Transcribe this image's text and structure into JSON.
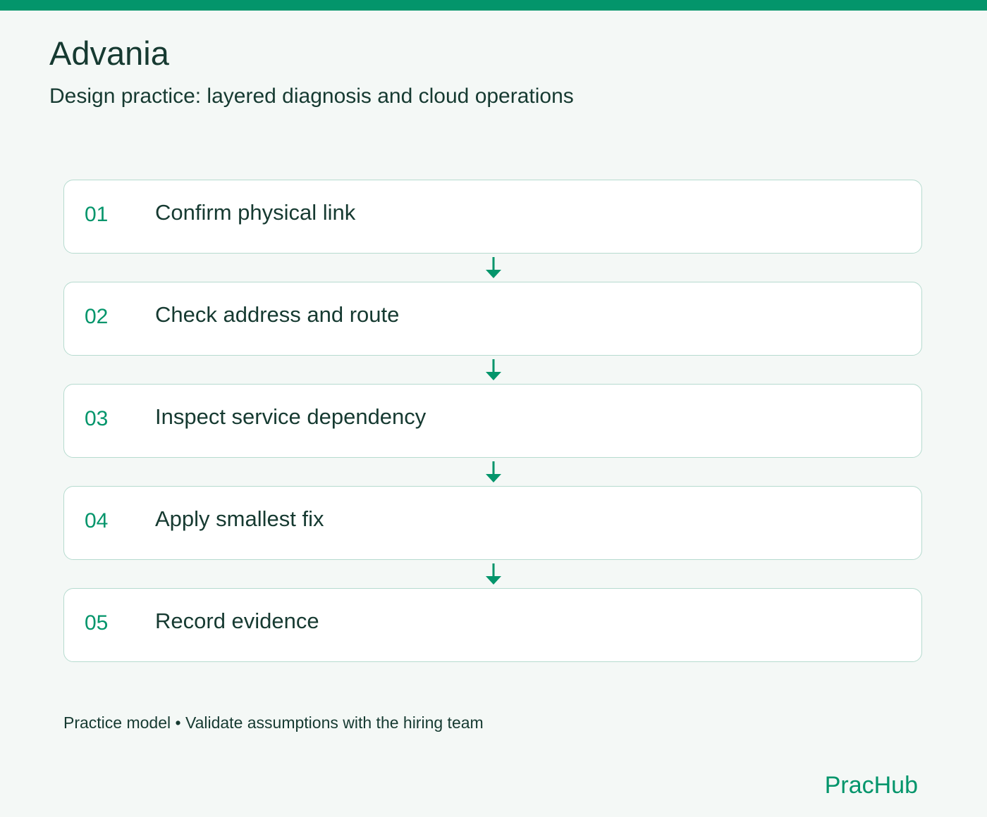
{
  "header": {
    "title": "Advania",
    "subtitle": "Design practice: layered diagnosis and cloud operations"
  },
  "steps": [
    {
      "number": "01",
      "label": "Confirm physical link"
    },
    {
      "number": "02",
      "label": "Check address and route"
    },
    {
      "number": "03",
      "label": "Inspect service dependency"
    },
    {
      "number": "04",
      "label": "Apply smallest fix"
    },
    {
      "number": "05",
      "label": "Record evidence"
    }
  ],
  "footer": {
    "note": "Practice model • Validate assumptions with the hiring team",
    "brand": "PracHub"
  },
  "colors": {
    "accent": "#03956b",
    "text": "#163a31",
    "background": "#f4f8f6",
    "card_border": "#b6dbcf",
    "card_background": "#ffffff"
  },
  "icons": {
    "connector": "arrow-down-icon"
  }
}
